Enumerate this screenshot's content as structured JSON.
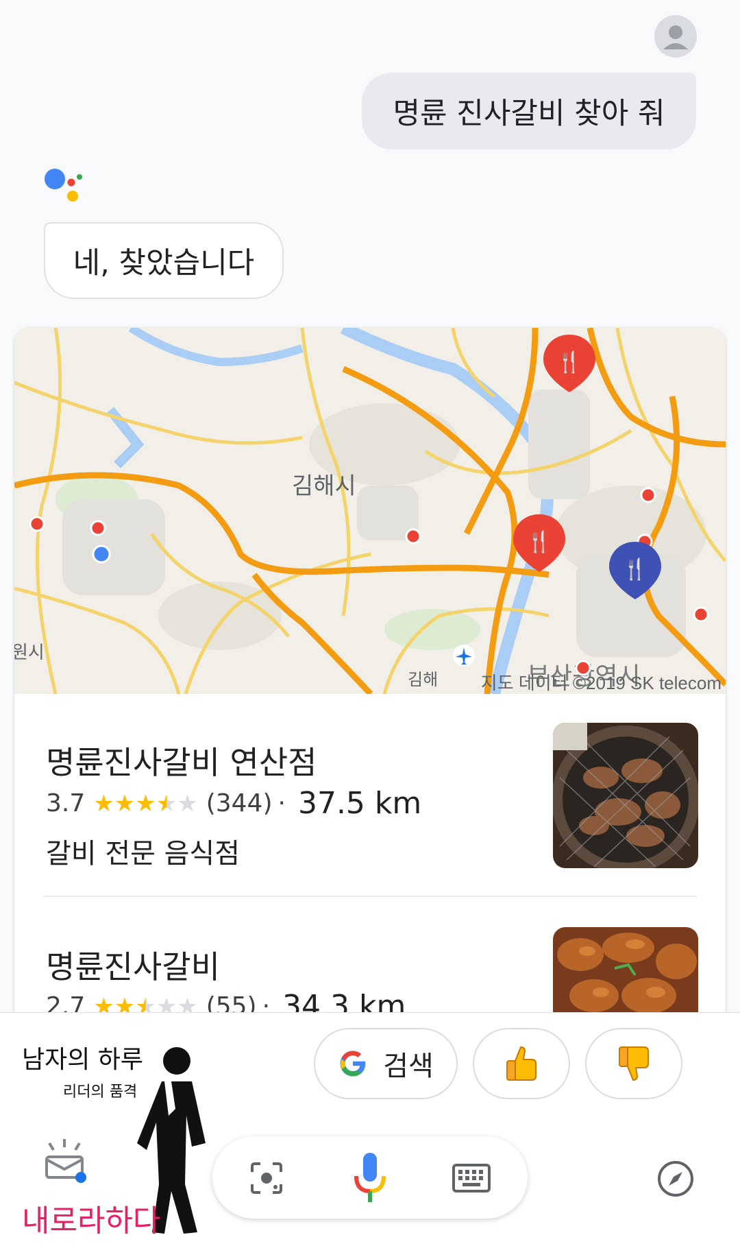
{
  "conversation": {
    "user_query": "명륜 진사갈비 찾아 줘",
    "assistant_reply": "네, 찾았습니다"
  },
  "map": {
    "city_label": "김해시",
    "left_edge_label": "원시",
    "district_label": "부산광역시",
    "airport_label": "김해",
    "attribution": "지도 데이터 ©2019 SK telecom"
  },
  "listings": [
    {
      "name": "명륜진사갈비 연산점",
      "rating": "3.7",
      "rating_value": 3.7,
      "reviews": "(344)",
      "separator": "·",
      "distance": "37.5 km",
      "category": "갈비 전문 음식점"
    },
    {
      "name": "명륜진사갈비",
      "rating": "2.7",
      "rating_value": 2.7,
      "reviews": "(55)",
      "separator": "·",
      "distance": "34.3 km"
    }
  ],
  "suggestions": {
    "search_label": "검색"
  },
  "watermark": {
    "line1": "남자의 하루",
    "line2": "리더의 품격",
    "line3": "내로라하다"
  },
  "colors": {
    "google_blue": "#4285f4",
    "google_red": "#ea4335",
    "google_yellow": "#fbbc04",
    "google_green": "#34a853",
    "star": "#fbbc04",
    "map_road": "#f9a825"
  }
}
